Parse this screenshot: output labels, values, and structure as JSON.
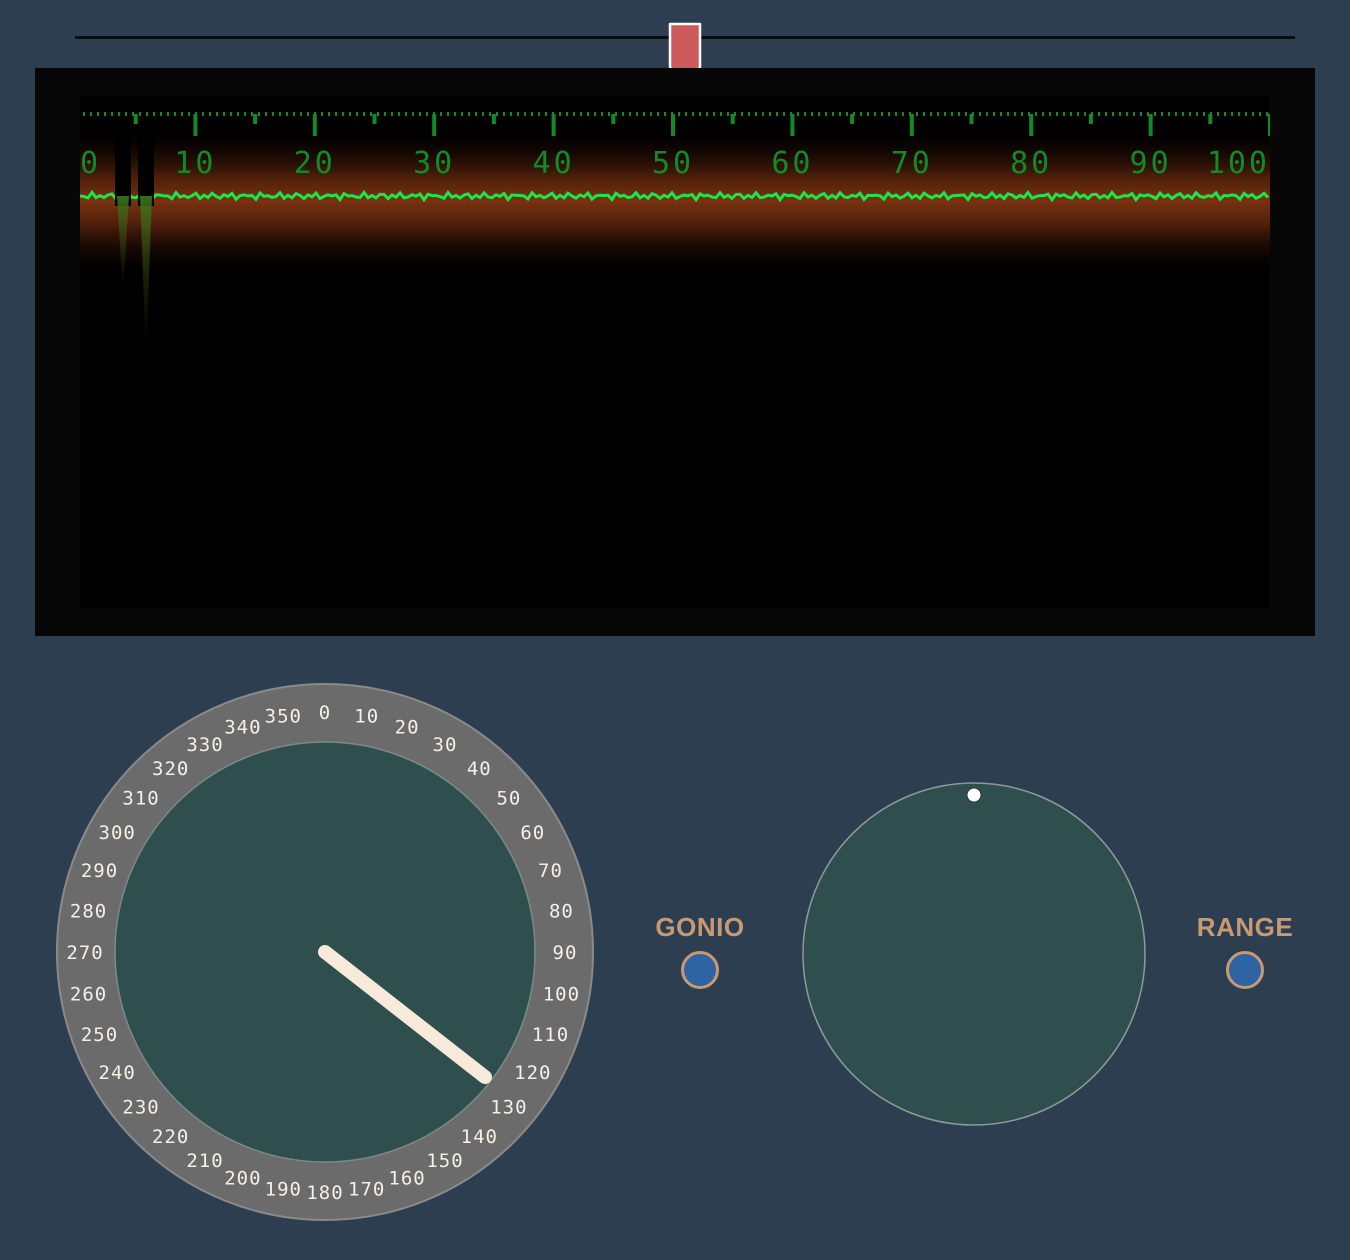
{
  "slider": {
    "position": 0.5
  },
  "scope": {
    "scale_labels": [
      "0",
      "10",
      "20",
      "30",
      "40",
      "50",
      "60",
      "70",
      "80",
      "90",
      "100"
    ],
    "range_max": 100,
    "trace_color": "#18e848",
    "glow_color": "#6e2a0c",
    "scale_color": "#138a2a"
  },
  "compass": {
    "labels": [
      "0",
      "10",
      "20",
      "30",
      "40",
      "50",
      "60",
      "70",
      "80",
      "90",
      "100",
      "110",
      "120",
      "130",
      "140",
      "150",
      "160",
      "170",
      "180",
      "190",
      "200",
      "210",
      "220",
      "230",
      "240",
      "250",
      "260",
      "270",
      "280",
      "290",
      "300",
      "310",
      "320",
      "330",
      "340",
      "350"
    ],
    "needle_bearing": 128,
    "ring_color": "#6b6b6b",
    "face_color": "#2f4f4e",
    "needle_color": "#f7eadb"
  },
  "range_dial": {
    "marker_bearing": 0,
    "face_color": "#2f4f4e"
  },
  "modes": {
    "gonio": "GONIO",
    "range": "RANGE",
    "label_color": "#c79a72",
    "button_color": "#2f64a4"
  }
}
